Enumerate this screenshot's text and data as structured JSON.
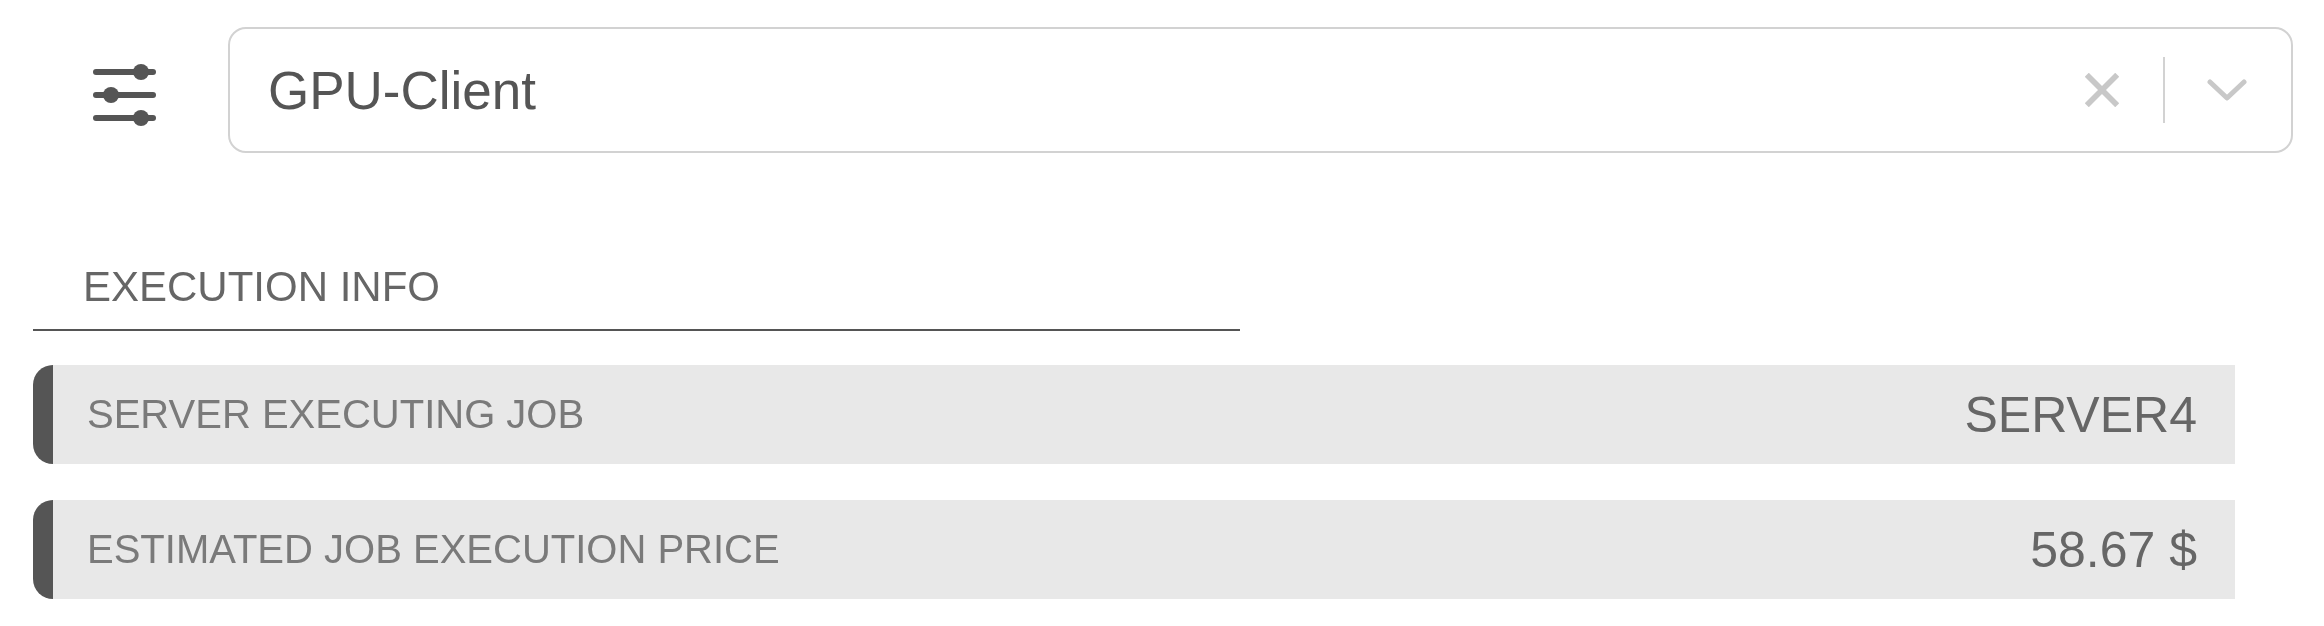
{
  "select": {
    "value": "GPU-Client"
  },
  "section": {
    "title": "EXECUTION INFO",
    "rows": [
      {
        "label": "SERVER EXECUTING JOB",
        "value": "SERVER4"
      },
      {
        "label": "ESTIMATED JOB EXECUTION PRICE",
        "value": "58.67 $"
      }
    ]
  }
}
